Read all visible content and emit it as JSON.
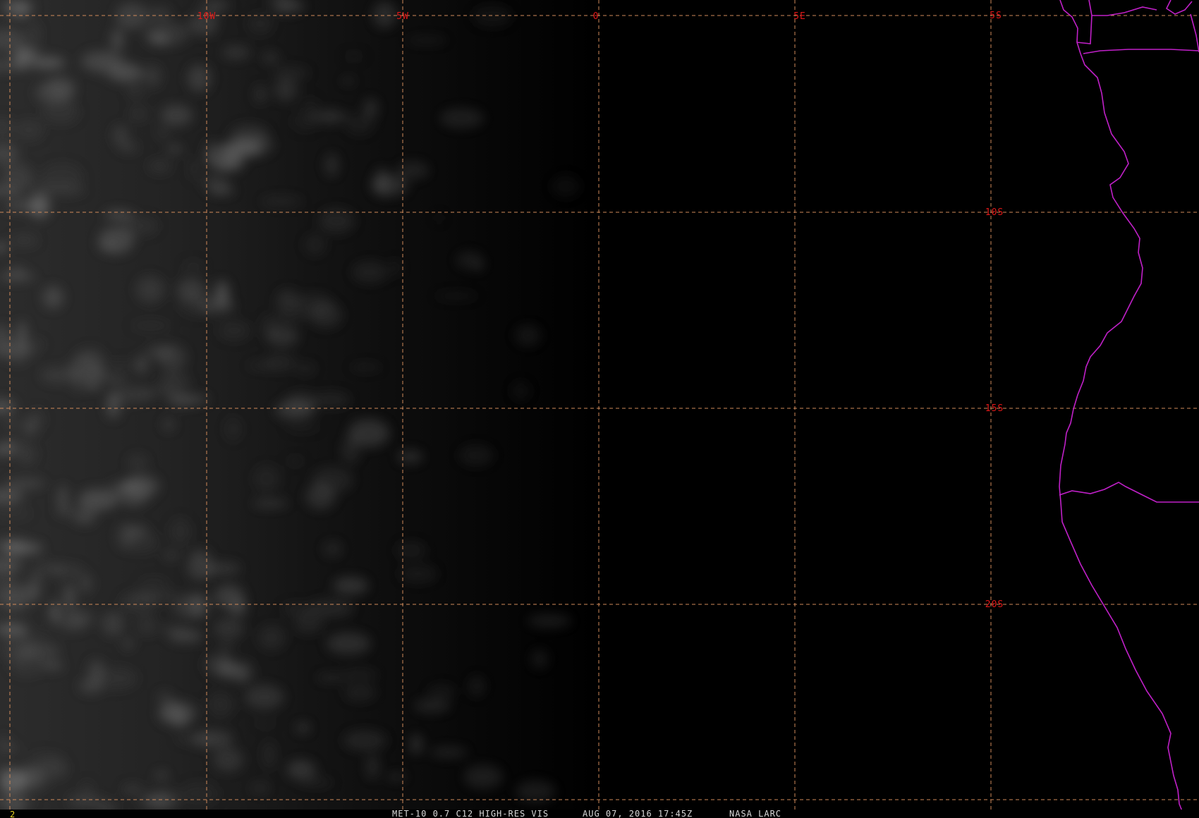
{
  "map": {
    "longitude_labels": [
      "10W",
      "5W",
      "0",
      "5E"
    ],
    "latitude_labels": [
      "5S",
      "10S",
      "15S",
      "20S"
    ],
    "frame_number": "2",
    "footer": {
      "product": "MET-10 0.7 C12 HIGH-RES VIS",
      "datetime": "AUG 07, 2016 17:45Z",
      "source": "NASA LARC"
    },
    "colors": {
      "background": "#000000",
      "grid": "#d08a5a",
      "grid_labels": "#e01818",
      "coastline": "#c020c8",
      "footer_text": "#d8d8d8",
      "frame_number": "#e8d020"
    }
  }
}
